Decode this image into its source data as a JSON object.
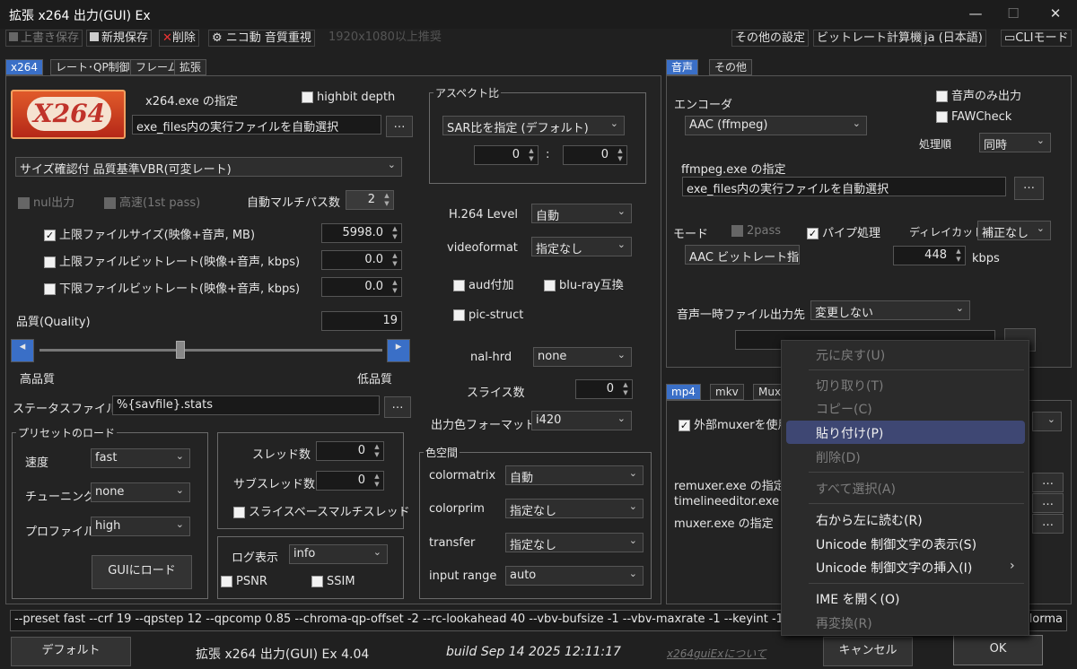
{
  "window": {
    "title": "拡張 x264 出力(GUI) Ex",
    "minimize": "—",
    "maximize": "☐",
    "close": "✕"
  },
  "toolbar": {
    "overwrite": "上書き保存",
    "save_new": "新規保存",
    "delete": "削除",
    "preset": "ニコ動 音質重視",
    "hint": "1920x1080以上推奨",
    "other_settings": "その他の設定",
    "bitrate_calc": "ビットレート計算機",
    "language": "ja (日本語)",
    "cli_mode": "CLIモード"
  },
  "left_tabs": [
    "x264",
    "レート･QP制御",
    "フレーム",
    "拡張"
  ],
  "x264": {
    "logo": "X264",
    "exe_label": "x264.exe の指定",
    "highbit": "highbit depth",
    "exe_path": "exe_files内の実行ファイルを自動選択",
    "mode": "サイズ確認付 品質基準VBR(可変レート)",
    "nul_out": "nul出力",
    "fast_first": "高速(1st pass)",
    "auto_multipass": "自動マルチパス数",
    "auto_multipass_val": "2",
    "max_size": "上限ファイルサイズ(映像+音声, MB)",
    "max_size_val": "5998.0",
    "max_bitrate": "上限ファイルビットレート(映像+音声, kbps)",
    "max_bitrate_val": "0.0",
    "min_bitrate": "下限ファイルビットレート(映像+音声, kbps)",
    "min_bitrate_val": "0.0",
    "quality": "品質(Quality)",
    "quality_val": "19",
    "quality_slider": 0.41,
    "high_q": "高品質",
    "low_q": "低品質",
    "stats": "ステータスファイル",
    "stats_val": "%{savfile}.stats",
    "preset_group": "プリセットのロード",
    "speed": "速度",
    "speed_val": "fast",
    "tuning": "チューニング",
    "tuning_val": "none",
    "profile": "プロファイル",
    "profile_val": "high",
    "load_gui": "GUIにロード",
    "threads": "スレッド数",
    "threads_val": "0",
    "subthreads": "サブスレッド数",
    "subthreads_val": "0",
    "slice_thread": "スライスベースマルチスレッド",
    "log": "ログ表示",
    "log_val": "info",
    "psnr": "PSNR",
    "ssim": "SSIM"
  },
  "aspect": {
    "group": "アスペクト比",
    "mode": "SAR比を指定 (デフォルト)",
    "w": "0",
    "h": "0",
    "colon": ":",
    "h264_level": "H.264 Level",
    "h264_level_val": "自動",
    "videoformat": "videoformat",
    "videoformat_val": "指定なし",
    "aud": "aud付加",
    "bluray": "blu-ray互換",
    "pic_struct": "pic-struct",
    "nal_hrd": "nal-hrd",
    "nal_hrd_val": "none",
    "slices": "スライス数",
    "slices_val": "0",
    "csp": "出力色フォーマット",
    "csp_val": "i420",
    "colorspace_group": "色空間",
    "colormatrix": "colormatrix",
    "colormatrix_val": "自動",
    "colorprim": "colorprim",
    "colorprim_val": "指定なし",
    "transfer": "transfer",
    "transfer_val": "指定なし",
    "input_range": "input range",
    "input_range_val": "auto"
  },
  "audio_tabs": [
    "音声",
    "その他"
  ],
  "audio": {
    "encoder": "エンコーダ",
    "encoder_val": "AAC (ffmpeg)",
    "audio_only": "音声のみ出力",
    "faw": "FAWCheck",
    "order": "処理順",
    "order_val": "同時",
    "exe_label": "ffmpeg.exe の指定",
    "exe_path": "exe_files内の実行ファイルを自動選択",
    "mode": "モード",
    "twopass": "2pass",
    "pipe": "パイプ処理",
    "delay": "ディレイカット",
    "delay_val": "補正なし",
    "mode_val": "AAC ビットレート指定",
    "bitrate_val": "448",
    "kbps": "kbps",
    "temp_out": "音声一時ファイル出力先",
    "temp_out_val": "変更しない"
  },
  "mux_tabs": [
    "mp4",
    "mkv",
    "Mux"
  ],
  "mux": {
    "external": "外部muxerを使用",
    "remuxer": "remuxer.exe の指定",
    "timeline": "timelineeditor.exe",
    "muxer": "muxer.exe の指定"
  },
  "cmdline": "--preset fast --crf 19 --qpstep 12 --qpcomp 0.85 --chroma-qp-offset -2 --rc-lookahead 40 --vbv-bufsize -1 --vbv-maxrate -1 --keyint -1 -",
  "cmdline_tail": "olorma",
  "footer": {
    "default": "デフォルト",
    "version": "拡張 x264 出力(GUI) Ex 4.04",
    "build": "build Sep 14 2025 12:11:17",
    "about": "x264guiExについて",
    "cancel": "キャンセル",
    "ok": "OK"
  },
  "context_menu": {
    "undo": "元に戻す(U)",
    "cut": "切り取り(T)",
    "copy": "コピー(C)",
    "paste": "貼り付け(P)",
    "delete": "削除(D)",
    "select_all": "すべて選択(A)",
    "rtl": "右から左に読む(R)",
    "show_unicode": "Unicode 制御文字の表示(S)",
    "insert_unicode": "Unicode 制御文字の挿入(I)",
    "open_ime": "IME を開く(O)",
    "reconvert": "再変換(R)"
  }
}
